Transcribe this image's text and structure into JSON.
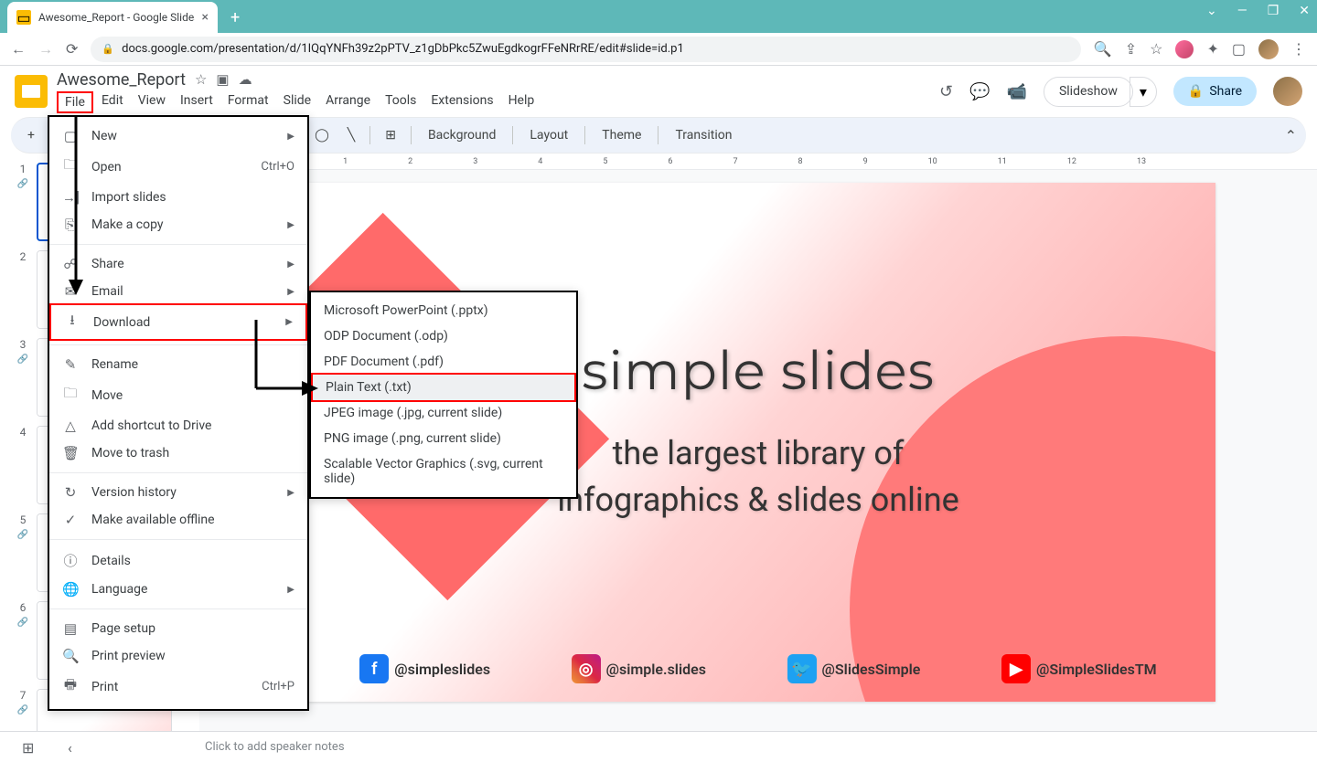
{
  "browser": {
    "tab_title": "Awesome_Report - Google Slides",
    "url": "docs.google.com/presentation/d/1IQqYNFh39z2pPTV_z1gDbPkc5ZwuEgdkogrFFeNRrRE/edit#slide=id.p1"
  },
  "doc": {
    "title": "Awesome_Report",
    "menus": [
      "File",
      "Edit",
      "View",
      "Insert",
      "Format",
      "Slide",
      "Arrange",
      "Tools",
      "Extensions",
      "Help"
    ],
    "slideshow": "Slideshow",
    "share": "Share"
  },
  "toolbar": {
    "background": "Background",
    "layout": "Layout",
    "theme": "Theme",
    "transition": "Transition"
  },
  "ruler": [
    "1",
    "",
    "1",
    "2",
    "3",
    "4",
    "5",
    "6",
    "7",
    "8",
    "9",
    "10",
    "11",
    "12",
    "13"
  ],
  "thumbs": [
    "1",
    "2",
    "3",
    "4",
    "5",
    "6",
    "7"
  ],
  "slide": {
    "title": "simple slides",
    "subtitle1": "the largest library of",
    "subtitle2": "infographics & slides online",
    "social_fb": "@simpleslides",
    "social_ig": "@simple.slides",
    "social_tw": "@SlidesSimple",
    "social_yt": "@SimpleSlidesTM"
  },
  "notes": {
    "placeholder": "Click to add speaker notes"
  },
  "file_menu": {
    "new": "New",
    "open": "Open",
    "open_sc": "Ctrl+O",
    "import": "Import slides",
    "make_copy": "Make a copy",
    "share_menu": "Share",
    "email": "Email",
    "download": "Download",
    "rename": "Rename",
    "move": "Move",
    "add_shortcut": "Add shortcut to Drive",
    "trash": "Move to trash",
    "version": "Version history",
    "offline": "Make available offline",
    "details": "Details",
    "language": "Language",
    "page_setup": "Page setup",
    "print_preview": "Print preview",
    "print": "Print",
    "print_sc": "Ctrl+P"
  },
  "download_sub": {
    "pptx": "Microsoft PowerPoint (.pptx)",
    "odp": "ODP Document (.odp)",
    "pdf": "PDF Document (.pdf)",
    "txt": "Plain Text (.txt)",
    "jpg": "JPEG image (.jpg, current slide)",
    "png": "PNG image (.png, current slide)",
    "svg": "Scalable Vector Graphics (.svg, current slide)"
  }
}
